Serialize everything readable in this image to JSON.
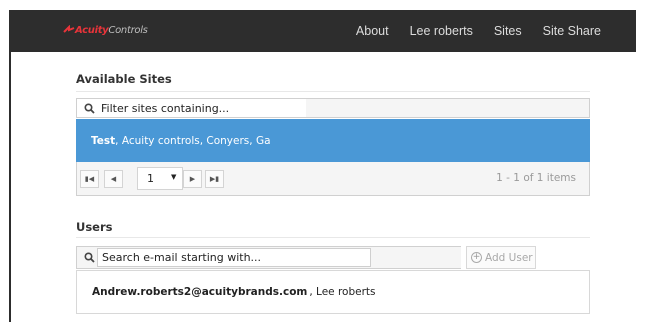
{
  "navbar": {
    "logo": {
      "acuity": "Acuity",
      "controls": "Controls"
    },
    "links": [
      "About",
      "Lee roberts",
      "Sites",
      "Site Share"
    ]
  },
  "sites": {
    "title": "Available Sites",
    "filter_text": "Filter sites containing...",
    "rows": [
      {
        "name": "Test",
        "details": " , Acuity controls, Conyers, Ga"
      }
    ],
    "pager": {
      "first_icon": "first-page-icon",
      "prev_icon": "prev-page-icon",
      "next_icon": "next-page-icon",
      "last_icon": "last-page-icon",
      "page": "1",
      "info": "1 - 1 of 1 items"
    }
  },
  "users": {
    "title": "Users",
    "search_text": "Search e-mail starting with...",
    "add_label": "Add User",
    "rows": [
      {
        "email": "Andrew.roberts2@acuitybrands.com",
        "name": ", Lee roberts"
      }
    ]
  },
  "colors": {
    "navbar": "#2d2d2d",
    "brand_red": "#e8343a",
    "selected_row": "#4a98d6"
  }
}
